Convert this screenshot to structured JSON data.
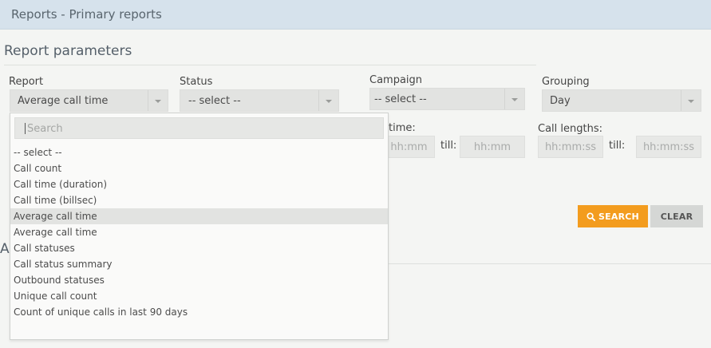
{
  "topbar": {
    "title": "Reports - Primary reports"
  },
  "section": {
    "title": "Report parameters",
    "under_letter": "A"
  },
  "fields": {
    "report": {
      "label": "Report",
      "value": "Average call time"
    },
    "status": {
      "label": "Status",
      "value": "-- select --"
    },
    "campaign": {
      "label": "Campaign",
      "value": "-- select --"
    },
    "grouping": {
      "label": "Grouping",
      "value": "Day"
    },
    "call_time": {
      "label": "time:",
      "from_placeholder": "hh:mm",
      "till_label": "till:",
      "till_placeholder": "hh:mm"
    },
    "call_lengths": {
      "label": "Call lengths:",
      "from_placeholder": "hh:mm:ss",
      "till_label": "till:",
      "till_placeholder": "hh:mm:ss"
    }
  },
  "buttons": {
    "search": "SEARCH",
    "clear": "CLEAR"
  },
  "dropdown": {
    "search_placeholder": "Search",
    "options": [
      "-- select --",
      "Call count",
      "Call time (duration)",
      "Call time (billsec)",
      "Average call time",
      "Average call time",
      "Call statuses",
      "Call status summary",
      "Outbound statuses",
      "Unique call count",
      "Count of unique calls in last 90 days"
    ],
    "highlighted_index": 4
  },
  "colors": {
    "accent": "#f39c1e",
    "topbar": "#d6e2ec"
  },
  "icons": {
    "search_button": "search-icon",
    "select_arrow": "chevron-down-icon"
  }
}
